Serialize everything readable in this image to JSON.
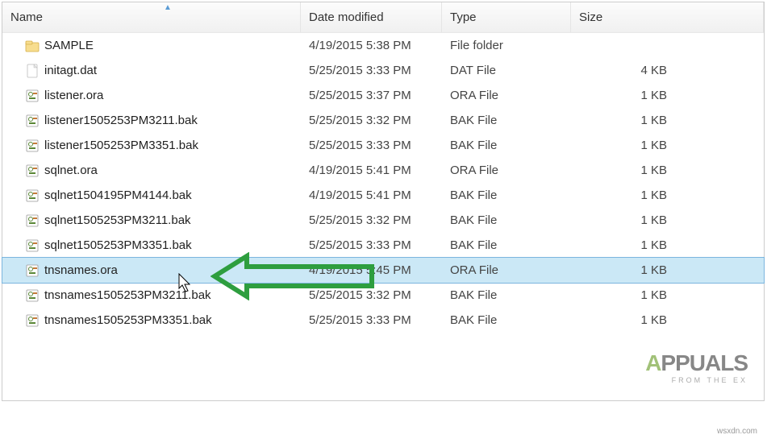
{
  "columns": {
    "name": "Name",
    "date": "Date modified",
    "type": "Type",
    "size": "Size"
  },
  "files": [
    {
      "icon": "folder",
      "name": "SAMPLE",
      "date": "4/19/2015 5:38 PM",
      "type": "File folder",
      "size": "",
      "selected": false
    },
    {
      "icon": "dat",
      "name": "initagt.dat",
      "date": "5/25/2015 3:33 PM",
      "type": "DAT File",
      "size": "4 KB",
      "selected": false
    },
    {
      "icon": "ora",
      "name": "listener.ora",
      "date": "5/25/2015 3:37 PM",
      "type": "ORA File",
      "size": "1 KB",
      "selected": false
    },
    {
      "icon": "bak",
      "name": "listener1505253PM3211.bak",
      "date": "5/25/2015 3:32 PM",
      "type": "BAK File",
      "size": "1 KB",
      "selected": false
    },
    {
      "icon": "bak",
      "name": "listener1505253PM3351.bak",
      "date": "5/25/2015 3:33 PM",
      "type": "BAK File",
      "size": "1 KB",
      "selected": false
    },
    {
      "icon": "ora",
      "name": "sqlnet.ora",
      "date": "4/19/2015 5:41 PM",
      "type": "ORA File",
      "size": "1 KB",
      "selected": false
    },
    {
      "icon": "bak",
      "name": "sqlnet1504195PM4144.bak",
      "date": "4/19/2015 5:41 PM",
      "type": "BAK File",
      "size": "1 KB",
      "selected": false
    },
    {
      "icon": "bak",
      "name": "sqlnet1505253PM3211.bak",
      "date": "5/25/2015 3:32 PM",
      "type": "BAK File",
      "size": "1 KB",
      "selected": false
    },
    {
      "icon": "bak",
      "name": "sqlnet1505253PM3351.bak",
      "date": "5/25/2015 3:33 PM",
      "type": "BAK File",
      "size": "1 KB",
      "selected": false
    },
    {
      "icon": "ora",
      "name": "tnsnames.ora",
      "date": "4/19/2015 5:45 PM",
      "type": "ORA File",
      "size": "1 KB",
      "selected": true
    },
    {
      "icon": "bak",
      "name": "tnsnames1505253PM3211.bak",
      "date": "5/25/2015 3:32 PM",
      "type": "BAK File",
      "size": "1 KB",
      "selected": false
    },
    {
      "icon": "bak",
      "name": "tnsnames1505253PM3351.bak",
      "date": "5/25/2015 3:33 PM",
      "type": "BAK File",
      "size": "1 KB",
      "selected": false
    }
  ],
  "watermark": {
    "brand_a": "A",
    "brand_rest": "PPUALS",
    "tagline": "FROM THE EX"
  },
  "source": "wsxdn.com"
}
